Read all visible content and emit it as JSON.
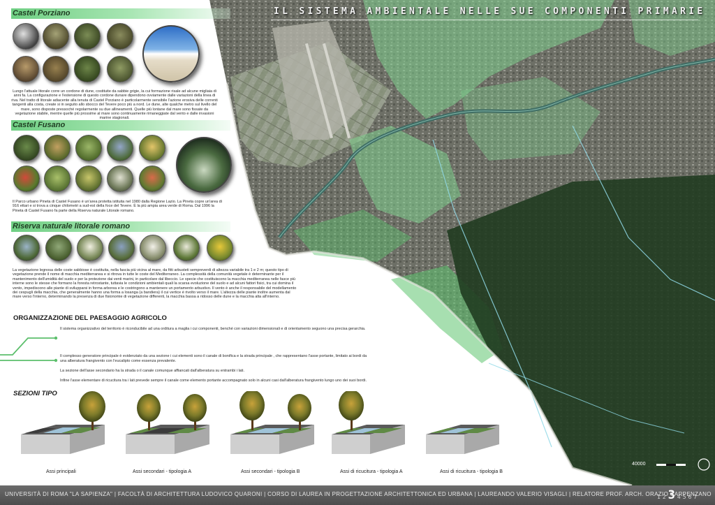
{
  "title": "IL SISTEMA AMBIENTALE NELLE SUE COMPONENTI PRIMARIE",
  "sections": {
    "castel_porziano": {
      "heading": "Castel Porziano",
      "text": "Lungo l'attuale litorale corre un cordone di dune, costituite da sabbie grigie, la cui formazione risale ad alcune migliaia di anni fa. La configurazione e l'estensione di questo cordone dunare dipendono ovviamente dalle variazioni della linea di riva. Nel tratto di litorale adiacente alla tenuta di Castel Porziano è particolarmente sensibile l'azione erosiva delle correnti tangenti alla costa, create si in seguito allo sbocco del Tevere poco più a nord. Le dune, alte qualche metro sul livello del mare, sono disposte pressoché regolarmente su due allineamenti. Quelle più lontane dal mare sono fissate da vegetazione stabile, mentre quelle più prossime al mare sono continuamente rimaneggiate dal vento e dalle invasioni marine stagionali."
    },
    "castel_fusano": {
      "heading": "Castel Fusano",
      "text": "Il Parco urbano Pineta di Castel Fusano è un'area protetta istituita nel 1980 dalla Regione Lazio. La Pineta copre un'area di 916 ettari e si trova a cinque chilometri a sud-est della foce del Tevere. È la più ampia area verde di Roma. Dal 1996 la Pineta di Castel Fusano fa parte della Riserva naturale Litorale romano."
    },
    "riserva": {
      "heading": "Riserva naturale litorale romano",
      "text": "La vegetazione legnosa delle coste sabbiose è costituita, nella fascia più vicina al mare, da fitti arbusteti sempreverdi di altezza variabile tra 1 e 2 m; questo tipo di vegetazione prende il nome di macchia mediterranea e si ritrova in tutte le coste del Mediterraneo. La complessità della comunità vegetale è determinante per il mantenimento dell'umidità del suolo e per la protezione dai venti marini, in particolare dal libeccio. Le specie che costituiscono la macchia mediterranea nelle fasce più interne sono le stesse che formano la foresta retrostante, tuttavia le condizioni ambientali quali la scarsa evoluzione del suolo e ad alcuni fattori fisici, tra cui domina il vento, impediscono alle piante di svilupparsi in forma arborea e le costringono a mantenere un portamento arbustivo. Il vento è anche il responsabile del modellamento dei cespugli della macchia, che generalmente hanno una forma a losanga (a bandiera) il cui vertice è rivolto verso il mare. L'altezza delle piante inoltre aumenta dal mare verso l'interno, determinando la presenza di due fisionomie di vegetazione differenti, la macchia bassa a ridosso delle dune e la macchia alta all'interno."
    }
  },
  "organizzazione": {
    "heading": "ORGANIZZAZIONE DEL PAESAGGIO AGRICOLO",
    "p1": "Il sistema organizzativo del territorio è riconducibile ad una orditura a maglia i cui componenti, benché con variazioni dimensionali e di orientamento seguono una precisa gerarchia.",
    "p2": "Il complesso generatore principale è evidenziato da una sezione i cui elementi sono il canale di bonifica e la strada principale , che rappresentano l'asse portante, limitato ai bordi da una alberatura frangivento con l'eucalipto come essenza prevalente.",
    "p3": "La sezione dell'asse secondario ha la strada o il canale comunque affiancati dall'alberatura su entrambi i lati.",
    "p4": "Infine l'asse elementare di ricucitura tra i lati prevede sempre il canale come elemento portante accompagnato solo in alcuni casi dall'alberatura frangivento lungo uno dei suoi bordi."
  },
  "sezioni": {
    "heading": "SEZIONI TIPO",
    "labels": [
      "Assi principali",
      "Assi secondari - tipologia A",
      "Assi secondari - tipologia B",
      "Assi di ricucitura - tipologia A",
      "Assi di ricucitura - tipologia B"
    ]
  },
  "scale_label": "40000",
  "footer": "UNIVERSITÀ DI ROMA \"LA SAPIENZA\" | FACOLTÀ DI ARCHITETTURA LUDOVICO QUARONI | CORSO DI LAUREA IN PROGETTAZIONE ARCHITETTONICA ED URBANA | LAUREANDO VALERIO VISAGLI | RELATORE PROF. ARCH. ORAZIO CARPENZANO",
  "page_numbers": {
    "before": "12",
    "current": "3",
    "after": "4567"
  },
  "colors": {
    "accent_green": "#6fcf83",
    "map_green": "#7fd08e",
    "footer_gray": "#5a5a5a"
  }
}
